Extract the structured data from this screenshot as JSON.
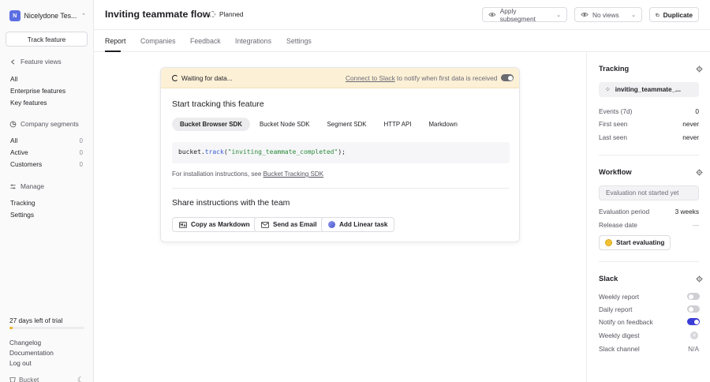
{
  "sidebar": {
    "org_initial": "N",
    "org_name": "Nicelydone Tes...",
    "track_feature": "Track feature",
    "feature_views_title": "Feature views",
    "feature_views": [
      "All",
      "Enterprise features",
      "Key features"
    ],
    "company_segments_title": "Company segments",
    "company_segments": [
      {
        "label": "All",
        "count": "0"
      },
      {
        "label": "Active",
        "count": "0"
      },
      {
        "label": "Customers",
        "count": "0"
      }
    ],
    "manage_title": "Manage",
    "manage_items": [
      "Tracking",
      "Settings"
    ],
    "trial_text": "27 days left of trial",
    "trial_progress": 0.04,
    "footer_links": [
      "Changelog",
      "Documentation",
      "Log out"
    ],
    "brand": "Bucket"
  },
  "header": {
    "title": "Inviting teammate flow",
    "stage": "Planned",
    "subsegment": "Apply subsegment",
    "views": "No views",
    "duplicate": "Duplicate"
  },
  "tabs": [
    "Report",
    "Companies",
    "Feedback",
    "Integrations",
    "Settings"
  ],
  "card": {
    "waiting": "Waiting for data...",
    "connect_link": "Connect to Slack",
    "connect_rest": "to notify when first data is received",
    "start_title": "Start tracking this feature",
    "sdk_tabs": [
      "Bucket Browser SDK",
      "Bucket Node SDK",
      "Segment SDK",
      "HTTP API",
      "Markdown"
    ],
    "code_obj": "bucket.",
    "code_fn": "track",
    "code_open": "(",
    "code_str": "\"inviting_teammate_completed\"",
    "code_close": ");",
    "install_prefix": "For installation instructions, see",
    "install_link": "Bucket Tracking SDK",
    "share_title": "Share instructions with the team",
    "btn_markdown": "Copy as Markdown",
    "btn_email": "Send as Email",
    "btn_linear": "Add Linear task"
  },
  "right": {
    "tracking_title": "Tracking",
    "event_name": "inviting_teammate_...",
    "events_label": "Events (7d)",
    "events_val": "0",
    "first_seen_label": "First seen",
    "first_seen_val": "never",
    "last_seen_label": "Last seen",
    "last_seen_val": "never",
    "workflow_title": "Workflow",
    "eval_status": "Evaluation not started yet",
    "eval_period_label": "Evaluation period",
    "eval_period_val": "3 weeks",
    "release_label": "Release date",
    "release_val": "—",
    "start_eval": "Start evaluating",
    "slack_title": "Slack",
    "weekly_report": "Weekly report",
    "daily_report": "Daily report",
    "notify_feedback": "Notify on feedback",
    "weekly_digest": "Weekly digest",
    "slack_channel": "Slack channel",
    "slack_channel_val": "N/A"
  }
}
